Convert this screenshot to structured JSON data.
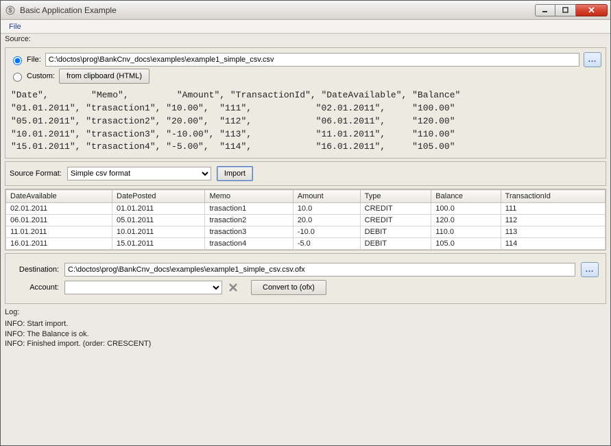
{
  "window": {
    "title": "Basic Application Example"
  },
  "menu": {
    "file": "File"
  },
  "source": {
    "label": "Source:",
    "file_label": "File:",
    "file_path": "C:\\doctos\\prog\\BankCnv_docs\\examples\\example1_simple_csv.csv",
    "browse": "...",
    "custom_label": "Custom:",
    "clipboard_btn": "from clipboard (HTML)"
  },
  "preview_text": "\"Date\",        \"Memo\",         \"Amount\", \"TransactionId\", \"DateAvailable\", \"Balance\"\n\"01.01.2011\", \"trasaction1\", \"10.00\",  \"111\",            \"02.01.2011\",     \"100.00\"\n\"05.01.2011\", \"trasaction2\", \"20.00\",  \"112\",            \"06.01.2011\",     \"120.00\"\n\"10.01.2011\", \"trasaction3\", \"-10.00\", \"113\",            \"11.01.2011\",     \"110.00\"\n\"15.01.2011\", \"trasaction4\", \"-5.00\",  \"114\",            \"16.01.2011\",     \"105.00\"",
  "format": {
    "label": "Source Format:",
    "selected": "Simple csv format",
    "import_btn": "Import"
  },
  "grid": {
    "headers": [
      "DateAvailable",
      "DatePosted",
      "Memo",
      "Amount",
      "Type",
      "Balance",
      "TransactionId"
    ],
    "rows": [
      [
        "02.01.2011",
        "01.01.2011",
        "trasaction1",
        "10.0",
        "CREDIT",
        "100.0",
        "111"
      ],
      [
        "06.01.2011",
        "05.01.2011",
        "trasaction2",
        "20.0",
        "CREDIT",
        "120.0",
        "112"
      ],
      [
        "11.01.2011",
        "10.01.2011",
        "trasaction3",
        "-10.0",
        "DEBIT",
        "110.0",
        "113"
      ],
      [
        "16.01.2011",
        "15.01.2011",
        "trasaction4",
        "-5.0",
        "DEBIT",
        "105.0",
        "114"
      ]
    ]
  },
  "destination": {
    "label": "Destination:",
    "path": "C:\\doctos\\prog\\BankCnv_docs\\examples\\example1_simple_csv.csv.ofx",
    "browse": "...",
    "account_label": "Account:",
    "account_value": "",
    "convert_btn": "Convert to (ofx)"
  },
  "log": {
    "label": "Log:",
    "text": "INFO: Start import.\nINFO: The Balance is ok.\nINFO: Finished import. (order: CRESCENT)"
  }
}
